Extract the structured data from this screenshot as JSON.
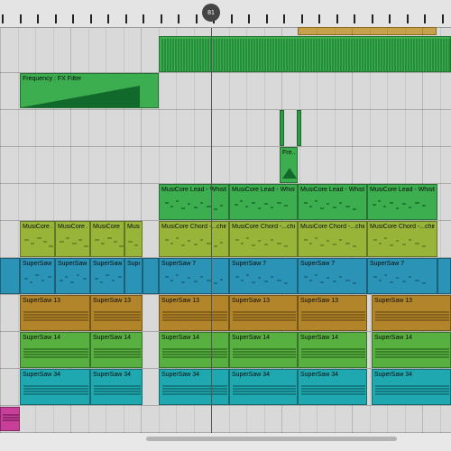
{
  "ruler": {
    "playhead_label": "81"
  },
  "colors": {
    "green": "#3cae4f",
    "green_dark": "#116a2b",
    "olive": "#98b53a",
    "blue": "#2b93b6",
    "brown": "#b3852a",
    "lime": "#58b041",
    "teal": "#1fa8b0",
    "magenta": "#c83f9a"
  },
  "clips": {
    "frequency_filter": "Frequency : FX Filter",
    "fx_short": "Fre...",
    "lead": [
      "MusiCore Lead - Whistle",
      "MusiCore Lead - Whistle",
      "MusiCore Lead - Whistle",
      "MusiCore Lead - Whistle"
    ],
    "chord_left": [
      "MusiCore ...",
      "MusiCore ...",
      "MusiCore ...",
      "MusiCo..."
    ],
    "chord_right": [
      "MusiCore Chord -...chine",
      "MusiCore Chord -...chine",
      "MusiCore Chord -...chine",
      "MusiCore Chord -...chine"
    ],
    "supersaw7_left": [
      "SuperSaw ...",
      "SuperSaw ...",
      "SuperSaw ...",
      "SuperSa..."
    ],
    "supersaw7_right": [
      "SuperSaw 7",
      "SuperSaw 7",
      "SuperSaw 7",
      "SuperSaw 7"
    ],
    "supersaw13_left": [
      "SuperSaw 13",
      "SuperSaw 13"
    ],
    "supersaw13_right": [
      "SuperSaw 13",
      "SuperSaw 13",
      "SuperSaw 13",
      "SuperSaw 13"
    ],
    "supersaw14_left": [
      "SuperSaw 14",
      "SuperSaw 14"
    ],
    "supersaw14_right": [
      "SuperSaw 14",
      "SuperSaw 14",
      "SuperSaw 14",
      "SuperSaw 14"
    ],
    "supersaw34_left": [
      "SuperSaw 34",
      "SuperSaw 34"
    ],
    "supersaw34_right": [
      "SuperSaw 34",
      "SuperSaw 34",
      "SuperSaw 34",
      "SuperSaw 34"
    ]
  }
}
